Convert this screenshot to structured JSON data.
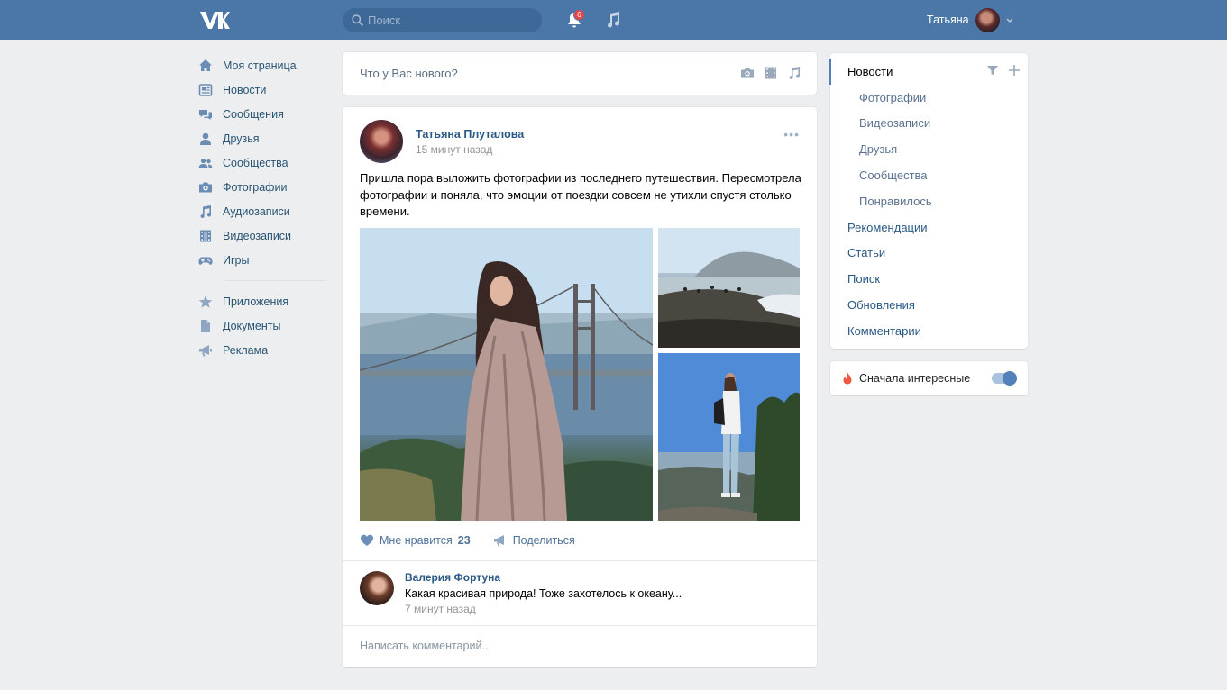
{
  "header": {
    "search_placeholder": "Поиск",
    "notification_count": "6",
    "user_name": "Татьяна"
  },
  "leftnav": {
    "items": [
      {
        "label": "Моя страница",
        "icon": "home-icon"
      },
      {
        "label": "Новости",
        "icon": "news-icon"
      },
      {
        "label": "Сообщения",
        "icon": "messages-icon"
      },
      {
        "label": "Друзья",
        "icon": "friends-icon"
      },
      {
        "label": "Сообщества",
        "icon": "communities-icon"
      },
      {
        "label": "Фотографии",
        "icon": "camera-icon"
      },
      {
        "label": "Аудиозаписи",
        "icon": "music-icon"
      },
      {
        "label": "Видеозаписи",
        "icon": "video-icon"
      },
      {
        "label": "Игры",
        "icon": "gamepad-icon"
      }
    ],
    "extra": [
      {
        "label": "Приложения",
        "icon": "star-icon"
      },
      {
        "label": "Документы",
        "icon": "document-icon"
      },
      {
        "label": "Реклама",
        "icon": "megaphone-icon"
      }
    ]
  },
  "composer": {
    "placeholder": "Что у Вас нового?"
  },
  "post": {
    "author": "Татьяна Плуталова",
    "time": "15 минут назад",
    "text": "Пришла пора выложить фотографии из последнего путешествия. Пересмотрела фотографии и поняла, что эмоции от поездки совсем не утихли спустя столько времени.",
    "like_label": "Мне нравится",
    "like_count": "23",
    "share_label": "Поделиться",
    "comment": {
      "author": "Валерия Фортуна",
      "text": "Какая красивая природа! Тоже захотелось к океану...",
      "time": "7 минут назад"
    },
    "comment_placeholder": "Написать комментарий..."
  },
  "rightmenu": {
    "items": [
      {
        "label": "Новости",
        "active": true
      },
      {
        "label": "Фотографии",
        "sub": true
      },
      {
        "label": "Видеозаписи",
        "sub": true
      },
      {
        "label": "Друзья",
        "sub": true
      },
      {
        "label": "Сообщества",
        "sub": true
      },
      {
        "label": "Понравилось",
        "sub": true
      },
      {
        "label": "Рекомендации"
      },
      {
        "label": "Статьи"
      },
      {
        "label": "Поиск"
      },
      {
        "label": "Обновления"
      },
      {
        "label": "Комментарии"
      }
    ]
  },
  "interesting": {
    "label": "Сначала интересные",
    "enabled": true
  },
  "colors": {
    "brand": "#4a76a8",
    "link": "#2a5885",
    "background": "#edeef0",
    "badge": "#e64646"
  }
}
